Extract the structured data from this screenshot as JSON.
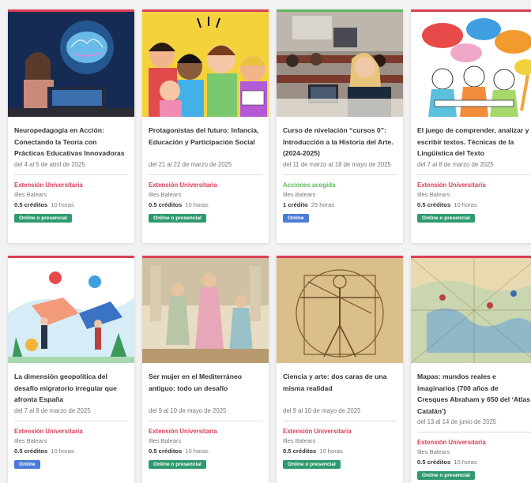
{
  "cards": [
    {
      "title": "Neuropedagogía en Acción: Conectando la Teoría con Prácticas Educativas Innovadoras",
      "date": "del 4 al 5 de abril de 2025",
      "category": "Extensión Universitaria",
      "place": "Illes Balears",
      "credits": "0.5 créditos",
      "hours": "10 horas",
      "badge": "Online o presencial",
      "image_icon": "brain-student-image"
    },
    {
      "title": "Protagonistas del futuro: Infancia, Educación y Participación Social",
      "date": "del 21 al 22 de marzo de 2025",
      "category": "Extensión Universitaria",
      "place": "Illes Balears",
      "credits": "0.5 créditos",
      "hours": "10 horas",
      "badge": "Online o presencial",
      "image_icon": "children-illustration-image"
    },
    {
      "title": "Curso de nivelación “cursos 0”: Introducción a la Historia del Arte. (2024-2025)",
      "date": "del 11 de marzo al 18 de mayo de 2025",
      "category": "Acciones acogida",
      "place": "Illes Balears",
      "credits": "1 crédito",
      "hours": "25 horas",
      "badge": "Online",
      "image_icon": "lecture-hall-image"
    },
    {
      "title": "El juego de comprender, analizar y escribir textos. Técnicas de la Lingüística del Texto",
      "date": "del 7 al 8 de marzo de 2025",
      "category": "Extensión Universitaria",
      "place": "Illes Balears",
      "credits": "0.5 créditos",
      "hours": "10 horas",
      "badge": "Online o presencial",
      "image_icon": "speech-bubbles-image"
    },
    {
      "title": "La dimensión geopolítica del desafío migratorio irregular que afronta España",
      "date": "del 7 al 8 de marzo de 2025",
      "category": "Extensión Universitaria",
      "place": "Illes Balears",
      "credits": "0.5 créditos",
      "hours": "10 horas",
      "badge": "Online",
      "image_icon": "migration-handshake-image"
    },
    {
      "title": "Ser mujer en el Mediterráneo antiguo: todo un desafío",
      "date": "del 9 al 10 de mayo de 2025",
      "category": "Extensión Universitaria",
      "place": "Illes Balears",
      "credits": "0.5 créditos",
      "hours": "10 horas",
      "badge": "Online o presencial",
      "image_icon": "ancient-women-image"
    },
    {
      "title": "Ciencia y arte: dos caras de una misma realidad",
      "date": "del 9 al 10 de mayo de 2025",
      "category": "Extensión Universitaria",
      "place": "Illes Balears",
      "credits": "0.5 créditos",
      "hours": "10 horas",
      "badge": "Online o presencial",
      "image_icon": "vitruvian-man-image"
    },
    {
      "title": "Mapas: mundos reales e imaginarios (700 años de Cresques Abraham y 650 del ‘Atlas Catalán’)",
      "date": "del 13 al 14 de junio de 2025",
      "category": "Extensión Universitaria",
      "place": "Illes Balears",
      "credits": "0.5 créditos",
      "hours": "10 horas",
      "badge": "Online o presencial",
      "image_icon": "ancient-map-image"
    }
  ],
  "colors": {
    "accent": "#d9405a",
    "green_category": "#5cb85c",
    "badge_green": "#2e9a6e",
    "badge_blue": "#4a7bd8"
  }
}
